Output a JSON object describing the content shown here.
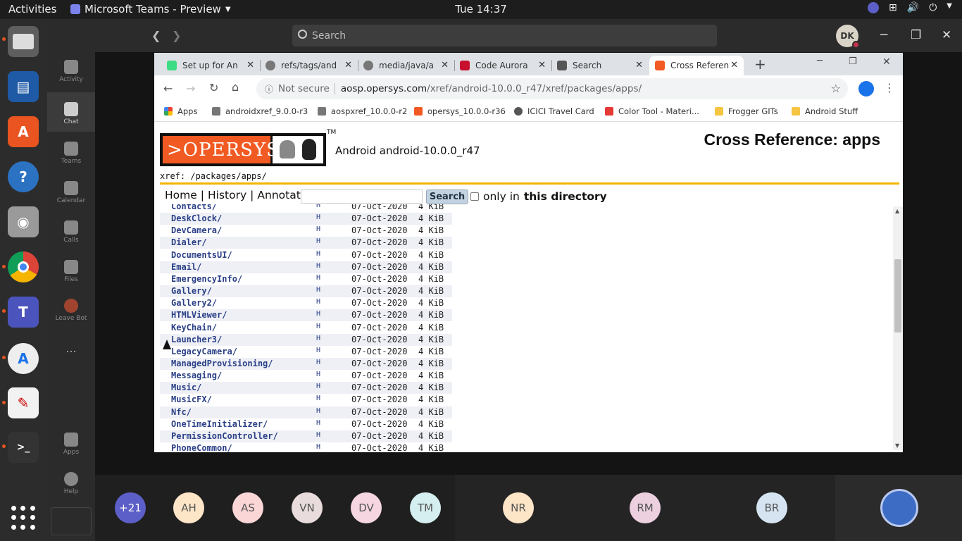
{
  "topbar": {
    "activities": "Activities",
    "app_name": "Microsoft Teams - Preview",
    "clock": "Tue 14:37"
  },
  "teams": {
    "rail": [
      {
        "label": "Activity"
      },
      {
        "label": "Chat"
      },
      {
        "label": "Teams"
      },
      {
        "label": "Calendar"
      },
      {
        "label": "Calls"
      },
      {
        "label": "Files"
      },
      {
        "label": "Leave Bot"
      },
      {
        "label": "..."
      },
      {
        "label": "Apps"
      },
      {
        "label": "Help"
      }
    ],
    "search_placeholder": "Search",
    "avatar_initials": "DK"
  },
  "browser": {
    "tabs": [
      {
        "title": "Set up for An",
        "icon_color": "#3ddc84"
      },
      {
        "title": "refs/tags/and",
        "icon_color": "#777777"
      },
      {
        "title": "media/java/a",
        "icon_color": "#777777"
      },
      {
        "title": "Code Aurora",
        "icon_color": "#c8102e"
      },
      {
        "title": "Search",
        "icon_color": "#555555"
      },
      {
        "title": "Cross Referen",
        "icon_color": "#f15a22"
      }
    ],
    "new_tab": "+",
    "omnibox": {
      "not_secure": "Not secure",
      "host": "aosp.opersys.com",
      "path": "/xref/android-10.0.0_r47/xref/packages/apps/"
    },
    "bookmarks": [
      {
        "label": "Apps"
      },
      {
        "label": "androidxref_9.0.0-r3"
      },
      {
        "label": "aospxref_10.0.0-r2"
      },
      {
        "label": "opersys_10.0.0-r36"
      },
      {
        "label": "ICICI Travel Card"
      },
      {
        "label": "Color Tool - Materi..."
      },
      {
        "label": "Frogger GITs"
      },
      {
        "label": "Android Stuff"
      }
    ]
  },
  "page": {
    "logo_text": ">OPERSYS",
    "tm": "TM",
    "project": "Android android-10.0.0_r47",
    "title": "Cross Reference: apps",
    "breadcrumb": "xref: /packages/apps/",
    "menu": {
      "home": "Home",
      "history": "History",
      "annotate": "Annotate",
      "search_button": "Search",
      "only_in": "only in",
      "this_directory": "this directory"
    },
    "listing": [
      {
        "name": "Contacts/",
        "h": "H",
        "date": "07-Oct-2020",
        "size": "4 KiB"
      },
      {
        "name": "DeskClock/",
        "h": "H",
        "date": "07-Oct-2020",
        "size": "4 KiB"
      },
      {
        "name": "DevCamera/",
        "h": "H",
        "date": "07-Oct-2020",
        "size": "4 KiB"
      },
      {
        "name": "Dialer/",
        "h": "H",
        "date": "07-Oct-2020",
        "size": "4 KiB"
      },
      {
        "name": "DocumentsUI/",
        "h": "H",
        "date": "07-Oct-2020",
        "size": "4 KiB"
      },
      {
        "name": "Email/",
        "h": "H",
        "date": "07-Oct-2020",
        "size": "4 KiB"
      },
      {
        "name": "EmergencyInfo/",
        "h": "H",
        "date": "07-Oct-2020",
        "size": "4 KiB"
      },
      {
        "name": "Gallery/",
        "h": "H",
        "date": "07-Oct-2020",
        "size": "4 KiB"
      },
      {
        "name": "Gallery2/",
        "h": "H",
        "date": "07-Oct-2020",
        "size": "4 KiB"
      },
      {
        "name": "HTMLViewer/",
        "h": "H",
        "date": "07-Oct-2020",
        "size": "4 KiB"
      },
      {
        "name": "KeyChain/",
        "h": "H",
        "date": "07-Oct-2020",
        "size": "4 KiB"
      },
      {
        "name": "Launcher3/",
        "h": "H",
        "date": "07-Oct-2020",
        "size": "4 KiB"
      },
      {
        "name": "LegacyCamera/",
        "h": "H",
        "date": "07-Oct-2020",
        "size": "4 KiB"
      },
      {
        "name": "ManagedProvisioning/",
        "h": "H",
        "date": "07-Oct-2020",
        "size": "4 KiB"
      },
      {
        "name": "Messaging/",
        "h": "H",
        "date": "07-Oct-2020",
        "size": "4 KiB"
      },
      {
        "name": "Music/",
        "h": "H",
        "date": "07-Oct-2020",
        "size": "4 KiB"
      },
      {
        "name": "MusicFX/",
        "h": "H",
        "date": "07-Oct-2020",
        "size": "4 KiB"
      },
      {
        "name": "Nfc/",
        "h": "H",
        "date": "07-Oct-2020",
        "size": "4 KiB"
      },
      {
        "name": "OneTimeInitializer/",
        "h": "H",
        "date": "07-Oct-2020",
        "size": "4 KiB"
      },
      {
        "name": "PermissionController/",
        "h": "H",
        "date": "07-Oct-2020",
        "size": "4 KiB"
      },
      {
        "name": "PhoneCommon/",
        "h": "H",
        "date": "07-Oct-2020",
        "size": "4 KiB"
      }
    ]
  },
  "participants": [
    {
      "initials": "+21",
      "color": "#5b5fc7"
    },
    {
      "initials": "AH",
      "color": "#fde5c7"
    },
    {
      "initials": "AS",
      "color": "#fbd6d6"
    },
    {
      "initials": "VN",
      "color": "#e9dcdc"
    },
    {
      "initials": "DV",
      "color": "#f6d6e0"
    },
    {
      "initials": "TM",
      "color": "#d5eef0"
    },
    {
      "initials": "NR",
      "color": "#fde5c7"
    },
    {
      "initials": "RM",
      "color": "#ecd0e0"
    },
    {
      "initials": "BR",
      "color": "#d6e4f2"
    }
  ]
}
